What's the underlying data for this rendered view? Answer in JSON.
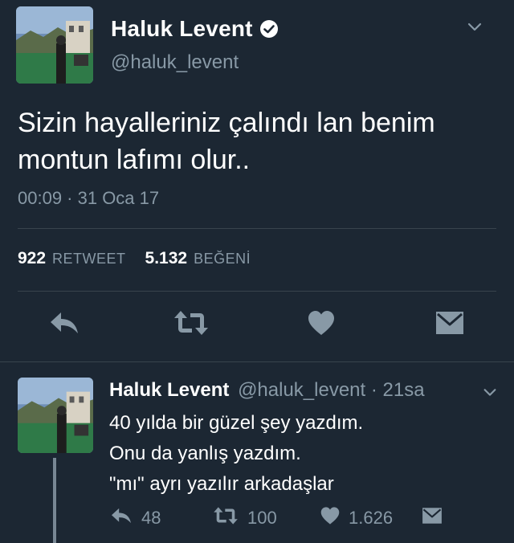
{
  "main_tweet": {
    "author": {
      "name": "Haluk Levent",
      "handle": "@haluk_levent",
      "verified": true
    },
    "text_lines": [
      "Sizin hayalleriniz çalındı lan benim",
      "montun lafımı olur.."
    ],
    "timestamp": "00:09 · 31 Oca 17",
    "stats": {
      "retweets_count": "922",
      "retweets_label": "RETWEET",
      "likes_count": "5.132",
      "likes_label": "BEĞENİ"
    },
    "actions": [
      "reply-icon",
      "retweet-icon",
      "heart-icon",
      "message-icon"
    ]
  },
  "reply_tweet": {
    "author": {
      "name": "Haluk Levent",
      "handle": "@haluk_levent"
    },
    "separator": "·",
    "time": "21sa",
    "text_lines": [
      "40 yılda bir güzel şey yazdım.",
      "Onu da yanlış yazdım.",
      "\"mı\" ayrı yazılır arkadaşlar"
    ],
    "counts": {
      "replies": "48",
      "retweets": "100",
      "likes": "1.626"
    }
  },
  "colors": {
    "background": "#1c2733",
    "primary_text": "#ffffff",
    "secondary_text": "#8899a6",
    "divider": "#38444d"
  }
}
